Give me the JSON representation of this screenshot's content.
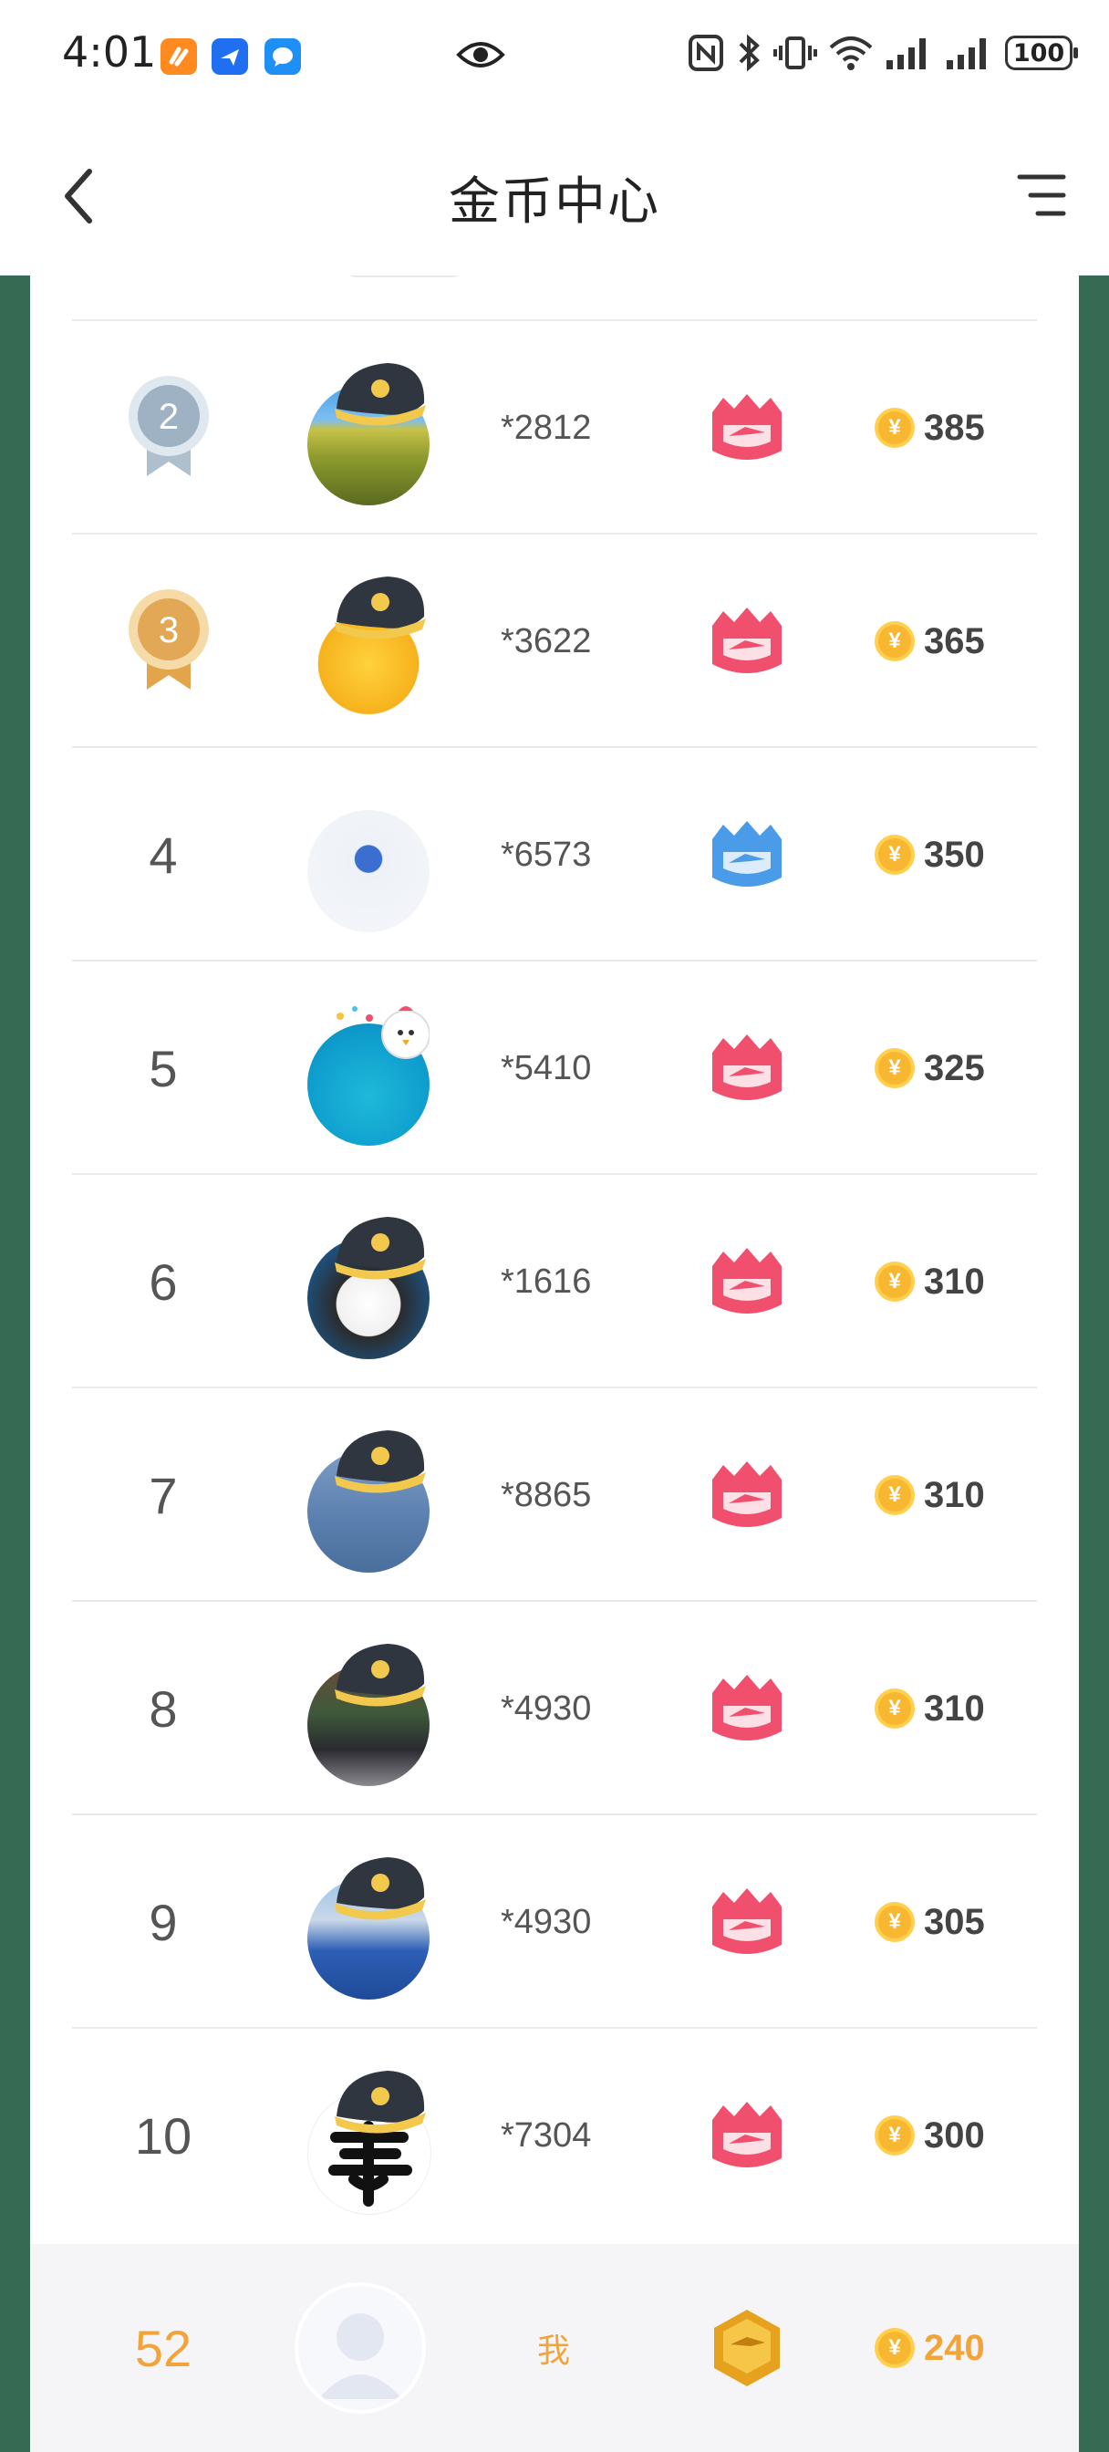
{
  "status_bar": {
    "time": "4:01",
    "battery": "100",
    "icons": [
      "app-orange-icon",
      "app-plane-icon",
      "app-message-icon",
      "eye-icon",
      "nfc-icon",
      "bluetooth-icon",
      "vibrate-icon",
      "wifi-icon",
      "signal-icon",
      "signal-icon",
      "battery-icon"
    ]
  },
  "header": {
    "title": "金币中心",
    "back_icon": "chevron-left-icon",
    "menu_icon": "menu-icon"
  },
  "colors": {
    "frame_green": "#366a52",
    "gold": "#f2a33a",
    "badge_red": "#f0506e",
    "badge_blue": "#4a9be8"
  },
  "leaderboard": {
    "rows": [
      {
        "rank": "2",
        "medal": "silver",
        "avatar": "field-avatar",
        "id": "*2812",
        "badge": "red",
        "coins": "385"
      },
      {
        "rank": "3",
        "medal": "bronze",
        "avatar": "tiger-avatar",
        "id": "*3622",
        "badge": "red",
        "coins": "365"
      },
      {
        "rank": "4",
        "medal": "",
        "avatar": "person-avatar",
        "id": "*6573",
        "badge": "blue",
        "coins": "350"
      },
      {
        "rank": "5",
        "medal": "",
        "avatar": "sea-avatar",
        "id": "*5410",
        "badge": "red",
        "coins": "325"
      },
      {
        "rank": "6",
        "medal": "",
        "avatar": "panda-avatar",
        "id": "*1616",
        "badge": "red",
        "coins": "310"
      },
      {
        "rank": "7",
        "medal": "",
        "avatar": "lake-avatar",
        "id": "*8865",
        "badge": "red",
        "coins": "310"
      },
      {
        "rank": "8",
        "medal": "",
        "avatar": "street-avatar",
        "id": "*4930",
        "badge": "red",
        "coins": "310"
      },
      {
        "rank": "9",
        "medal": "",
        "avatar": "blue-hood-avatar",
        "id": "*4930",
        "badge": "red",
        "coins": "305"
      },
      {
        "rank": "10",
        "medal": "",
        "avatar": "calligraphy-avatar",
        "id": "*7304",
        "badge": "red",
        "coins": "300"
      }
    ]
  },
  "me": {
    "rank": "52",
    "label": "我",
    "coins": "240",
    "badge": "gold"
  }
}
